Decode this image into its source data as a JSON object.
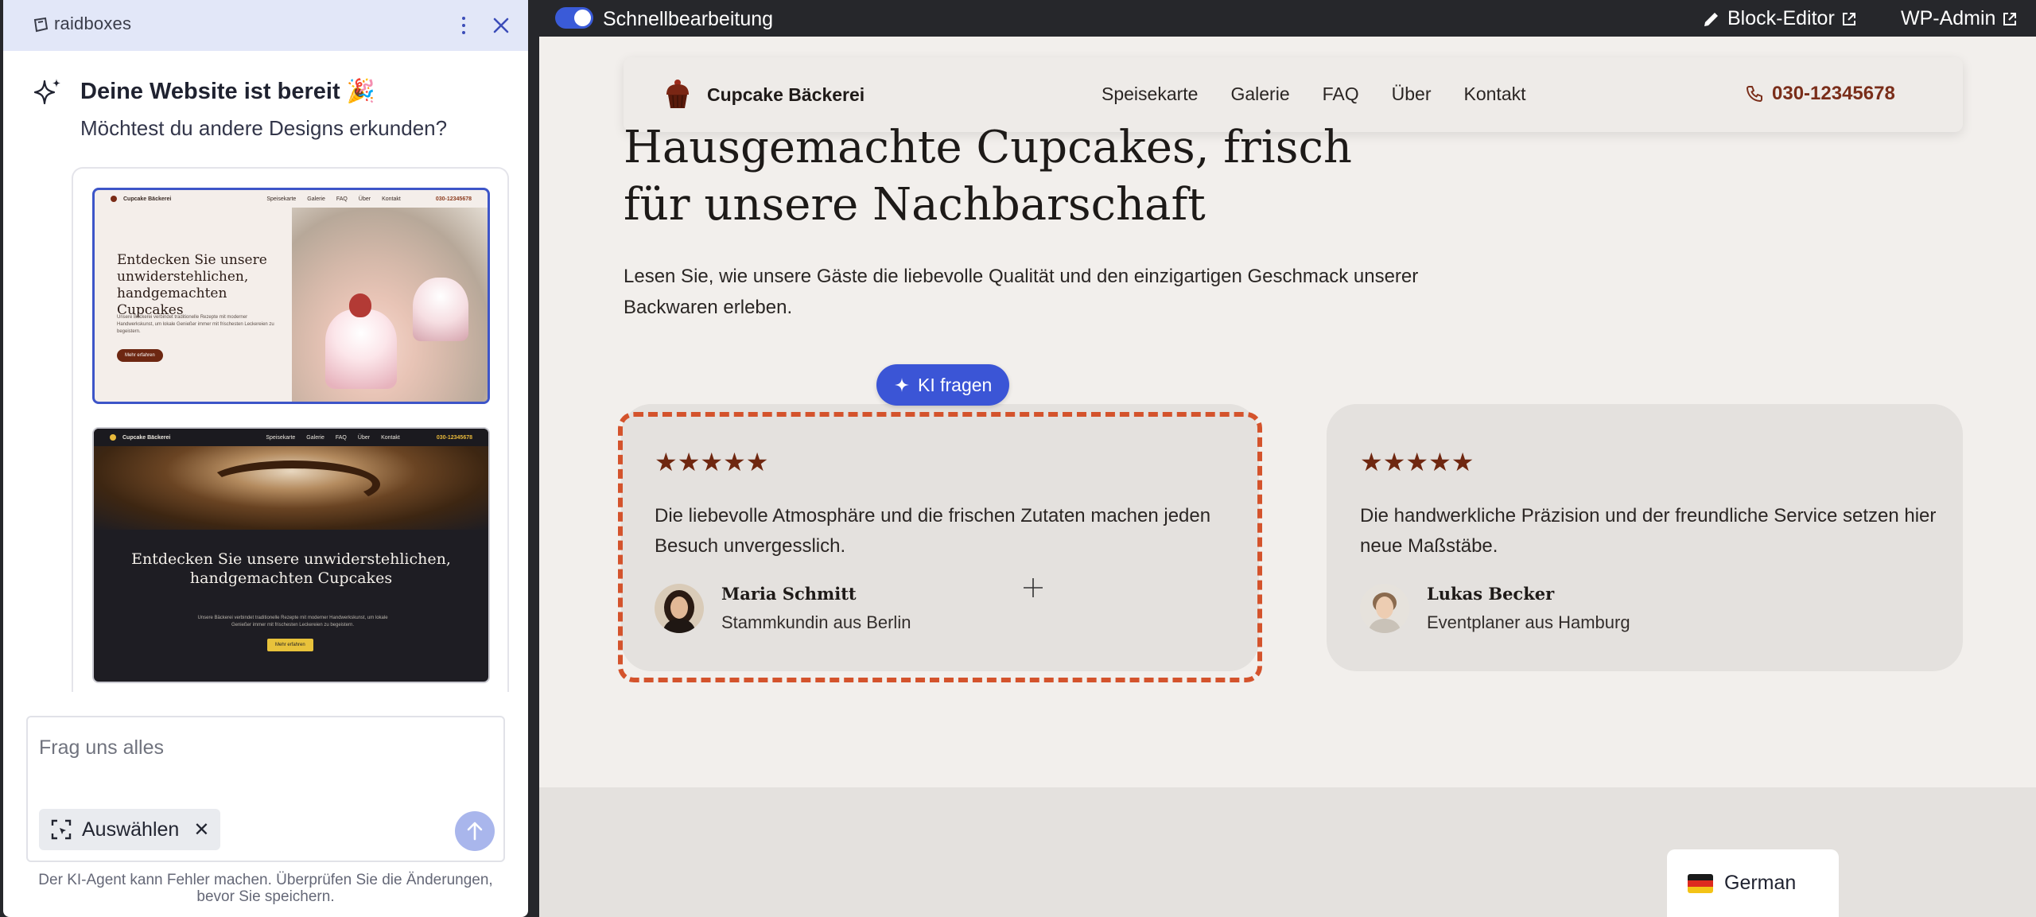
{
  "panel": {
    "brand": "raidboxes",
    "ready_title": "Deine Website ist bereit 🎉",
    "ready_subtitle": "Möchtest du andere Designs erkunden?",
    "designs": [
      {
        "brand": "Cupcake Bäckerei",
        "nav": [
          "Speisekarte",
          "Galerie",
          "FAQ",
          "Über",
          "Kontakt"
        ],
        "phone": "030-12345678",
        "heading": "Entdecken Sie unsere un­widerstehlichen, hand­ge­machten Cupcakes",
        "text": "Unsere Bäckerei verbindet traditionelle Rezepte mit moderner Handwerkskunst, um lokale Genießer immer mit frischesten Leckereien zu begeistern.",
        "button": "Mehr erfahren"
      },
      {
        "brand": "Cupcake Bäckerei",
        "nav": [
          "Speisekarte",
          "Galerie",
          "FAQ",
          "Über",
          "Kontakt"
        ],
        "phone": "030-12345678",
        "heading": "Entdecken Sie unsere unwiderstehlichen, handgemachten Cupcakes",
        "text": "Unsere Bäckerei verbindet traditionelle Rezepte mit moderner Handwerkskunst, um lokale Genießer immer mit frischesten Leckereien zu begeistern.",
        "button": "Mehr erfahren"
      }
    ],
    "chat": {
      "placeholder": "Frag uns alles",
      "select_chip": "Auswählen",
      "select_remove": "✕"
    },
    "disclaimer": "Der KI-Agent kann Fehler machen. Überprüfen Sie die Änderungen, bevor Sie speichern."
  },
  "toolbar": {
    "quick_edit_label": "Schnellbearbeitung",
    "quick_edit_on": true,
    "block_editor": "Block-Editor",
    "wp_admin": "WP-Admin"
  },
  "site": {
    "name": "Cupcake Bäckerei",
    "menu": [
      "Speisekarte",
      "Galerie",
      "FAQ",
      "Über",
      "Kontakt"
    ],
    "phone": "030-12345678",
    "hero_title": "Hausgemachte Cupcakes, frisch für unsere Nachbarschaft",
    "hero_subtitle": "Lesen Sie, wie unsere Gäste die liebevolle Qualität und den einzigartigen Geschmack unserer Backwaren erleben.",
    "ki_button": "KI fragen",
    "reviews": [
      {
        "stars": "★★★★★",
        "rating": 5,
        "text": "Die liebevolle Atmosphäre und die frischen Zutaten machen jeden Besuch unvergesslich.",
        "name": "Maria Schmitt",
        "role": "Stammkundin aus Berlin"
      },
      {
        "stars": "★★★★★",
        "rating": 5,
        "text": "Die handwerkliche Präzision und der freundliche Service setzen hier neue Maßstäbe.",
        "name": "Lukas Becker",
        "role": "Eventplaner aus Hamburg"
      }
    ],
    "language": "German"
  },
  "colors": {
    "accent_blue": "#3b55d6",
    "brand_brown": "#6f2710",
    "selection_orange": "#d4532c",
    "panel_header": "#e2e7f8"
  }
}
